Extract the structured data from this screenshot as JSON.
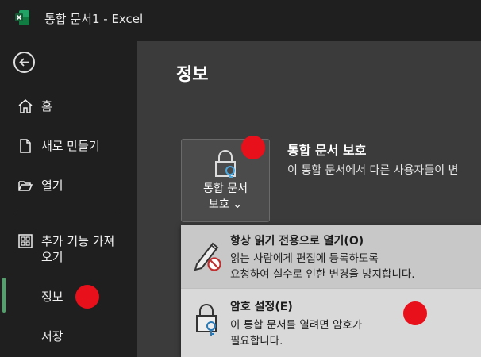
{
  "window": {
    "title": "통합 문서1  -  Excel"
  },
  "sidebar": {
    "items": [
      {
        "label": "홈"
      },
      {
        "label": "새로 만들기"
      },
      {
        "label": "열기"
      },
      {
        "label_line1": "추가 기능 가져",
        "label_line2": "오기"
      },
      {
        "label": "정보"
      },
      {
        "label": "저장"
      }
    ]
  },
  "main": {
    "title": "정보",
    "protect": {
      "button_line1": "통합 문서",
      "button_line2": "보호 ⌄",
      "heading": "통합 문서 보호",
      "description": "이 통합 문서에서 다른 사용자들이 변"
    },
    "menu": [
      {
        "title": "항상 읽기 전용으로 열기(O)",
        "desc1": "읽는 사람에게 편집에 등록하도록",
        "desc2": "요청하여 실수로 인한 변경을 방지합니다."
      },
      {
        "title": "암호 설정(E)",
        "desc1": "이 통합 문서를 열려면 암호가",
        "desc2": "필요합니다."
      }
    ]
  },
  "colors": {
    "accent": "#4ea36a",
    "marker": "#e8101a",
    "excel": "#107c41"
  }
}
